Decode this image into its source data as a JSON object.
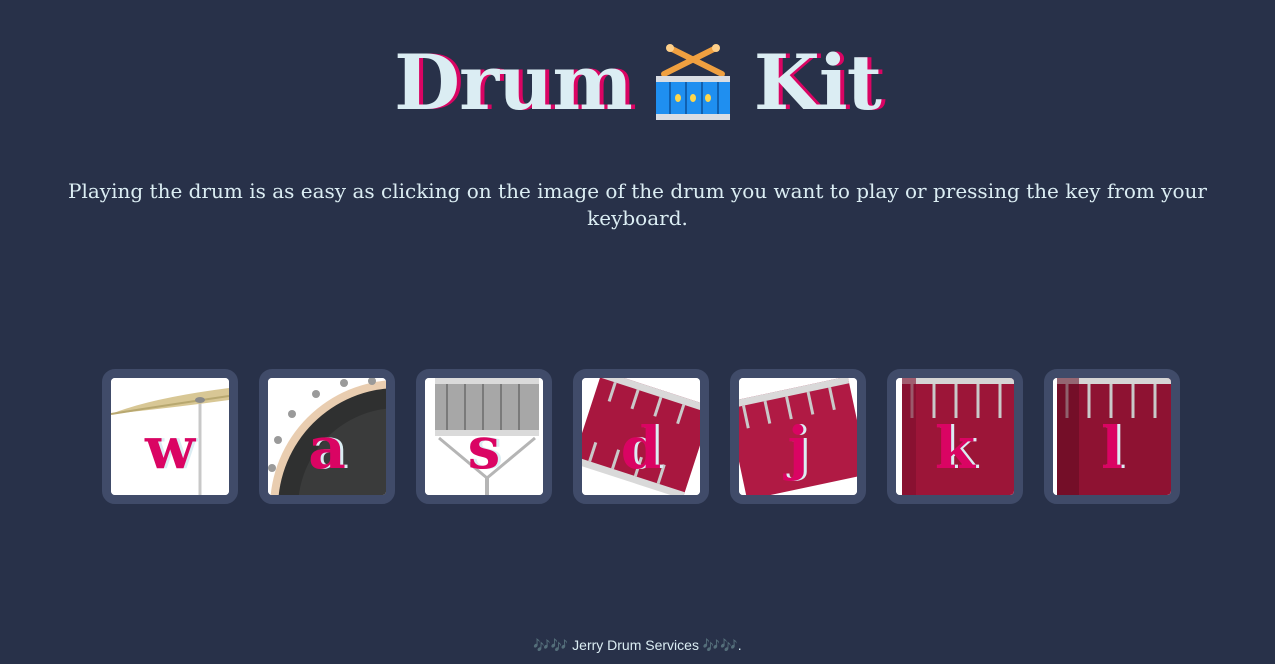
{
  "header": {
    "title_left": "Drum",
    "title_right": "Kit",
    "title_icon": "drum-emoji"
  },
  "intro": {
    "text": "Playing the drum is as easy as clicking on the image of the drum you want to play or pressing the key from your keyboard."
  },
  "drums": [
    {
      "key": "w",
      "image": "crash-cymbal"
    },
    {
      "key": "a",
      "image": "kick-drum"
    },
    {
      "key": "s",
      "image": "snare-drum"
    },
    {
      "key": "d",
      "image": "tom-1"
    },
    {
      "key": "j",
      "image": "tom-2"
    },
    {
      "key": "k",
      "image": "tom-3"
    },
    {
      "key": "l",
      "image": "tom-4"
    }
  ],
  "footer": {
    "notes_left": "🎶🎶",
    "text": "Jerry Drum Services",
    "notes_right": "🎶🎶",
    "end": "."
  },
  "colors": {
    "background": "#283149",
    "accent": "#DA0463",
    "text": "#DBEDF3",
    "tile_border": "#404B69",
    "drum_red": "#a8173f"
  }
}
